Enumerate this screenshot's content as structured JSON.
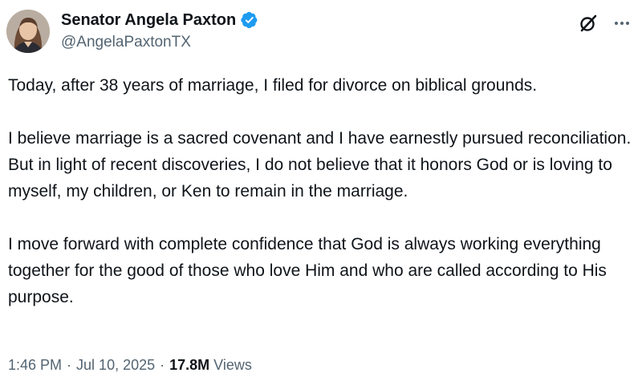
{
  "author": {
    "display_name": "Senator Angela Paxton",
    "handle": "@AngelaPaxtonTX",
    "verified": true,
    "verified_icon": "verified-badge-icon",
    "verified_color": "#1d9bf0"
  },
  "tweet": {
    "paragraphs": [
      "Today, after 38 years of marriage, I filed for divorce on biblical grounds.",
      "I believe marriage is a sacred covenant and I have earnestly pursued reconciliation. But in light of recent discoveries, I do not believe that it honors God or is loving to myself, my children, or Ken to remain in the marriage.",
      "I move forward with complete confidence that God is always working everything together for the good of those who love Him and who are called according to His purpose."
    ]
  },
  "meta": {
    "time": "1:46 PM",
    "separator": "·",
    "date": "Jul 10, 2025",
    "views_count": "17.8M",
    "views_label": "Views"
  },
  "icons": {
    "grok": "grok-icon",
    "more": "more-options-icon"
  },
  "colors": {
    "text_primary": "#0f1419",
    "text_secondary": "#536471",
    "accent": "#1d9bf0"
  }
}
